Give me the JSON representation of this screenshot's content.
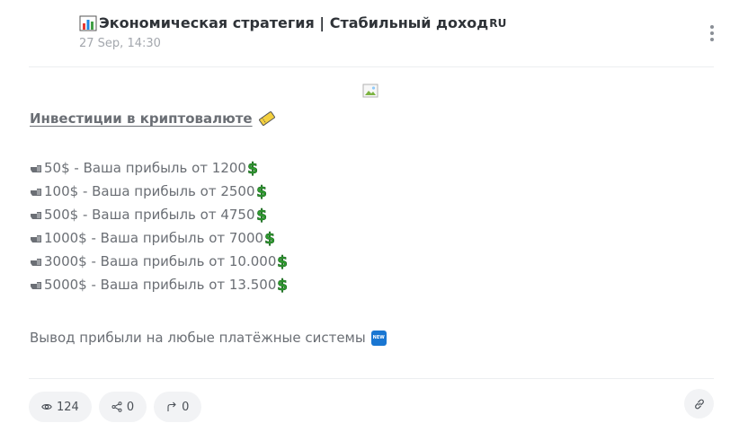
{
  "channel": {
    "title": "Экономическая стратегия | Стабильный доход",
    "flag_text": "RU",
    "date": "27 Sep, 14:30"
  },
  "post": {
    "link_text": "Инвестиции в криптовалюте",
    "offers": [
      {
        "text": "50$ - Ваша прибыль от 1200"
      },
      {
        "text": "100$ - Ваша прибыль от 2500"
      },
      {
        "text": "500$ - Ваша прибыль от 4750"
      },
      {
        "text": "1000$ - Ваша прибыль от 7000"
      },
      {
        "text": "3000$ - Ваша прибыль от 10.000"
      },
      {
        "text": "5000$ - Ваша прибыль от 13.500"
      }
    ],
    "withdraw_text": "Вывод прибыли на любые платёжные системы",
    "new_badge": "NEW"
  },
  "stats": {
    "views": "124",
    "reactions": "0",
    "shares": "0"
  },
  "colors": {
    "dollar_green": "#2e9e2e",
    "badge_blue": "#1976d2",
    "pill_bg": "#f2f3f5"
  },
  "icons": {
    "chart": "bar-chart-emoji",
    "ticket": "ticket-emoji",
    "hand": "pointing-hand-icon",
    "dollar": "heavy-dollar-sign-emoji",
    "views": "eye-icon",
    "reactions": "share-nodes-icon",
    "shares": "forward-arrow-icon",
    "link": "link-icon",
    "menu": "vertical-dots-icon"
  }
}
